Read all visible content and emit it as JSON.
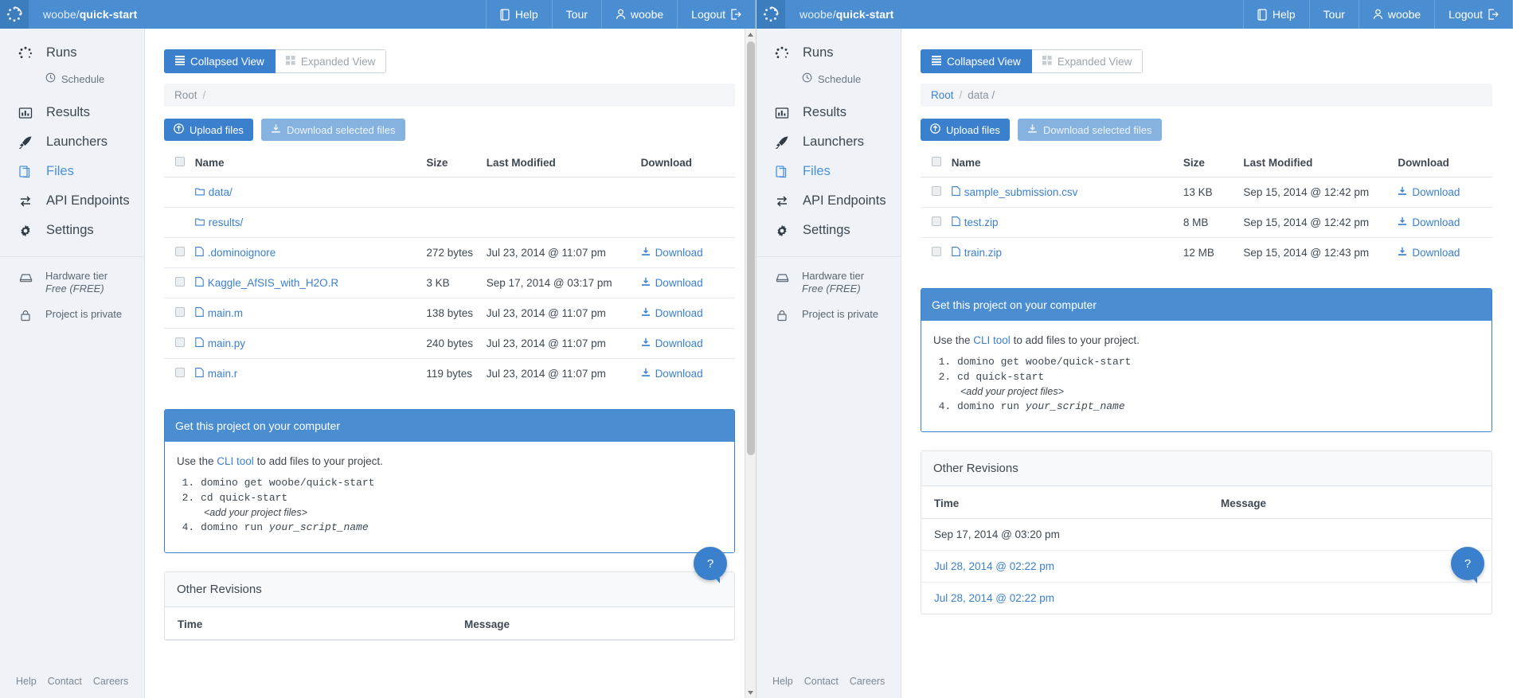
{
  "topbar": {
    "owner": "woobe/",
    "project": "quick-start",
    "nav": [
      {
        "label": "Help",
        "icon": "book-icon"
      },
      {
        "label": "Tour",
        "icon": null
      },
      {
        "label": "woobe",
        "icon": "user-icon"
      },
      {
        "label": "Logout",
        "icon": "logout-icon"
      }
    ]
  },
  "sidebar": {
    "items": [
      {
        "label": "Runs",
        "icon": "spinner-icon",
        "active": false
      },
      {
        "label": "Results",
        "icon": "chart-icon",
        "active": false
      },
      {
        "label": "Launchers",
        "icon": "rocket-icon",
        "active": false
      },
      {
        "label": "Files",
        "icon": "files-icon",
        "active": true
      },
      {
        "label": "API Endpoints",
        "icon": "api-icon",
        "active": false
      },
      {
        "label": "Settings",
        "icon": "gear-icon",
        "active": false
      }
    ],
    "sub_item": {
      "label": "Schedule",
      "icon": "clock-icon"
    },
    "hardware": {
      "label": "Hardware tier",
      "value": "Free  (FREE)",
      "icon": "hardware-icon"
    },
    "privacy": {
      "label": "Project is private",
      "icon": "lock-icon"
    },
    "footer": {
      "links": [
        "Help",
        "Contact",
        "Careers"
      ],
      "menu_icon": "hamburger-icon"
    }
  },
  "view_toggle": {
    "collapsed": "Collapsed View",
    "expanded": "Expanded View",
    "active": "collapsed"
  },
  "buttons": {
    "upload": "Upload files",
    "download_selected": "Download selected files"
  },
  "table_headers": {
    "name": "Name",
    "size": "Size",
    "last_modified": "Last Modified",
    "download": "Download"
  },
  "download_label": "Download",
  "left": {
    "breadcrumb": {
      "root": "Root",
      "sep": "/",
      "path": ""
    },
    "rows": [
      {
        "name": "data/",
        "type": "folder",
        "size": "",
        "modified": "",
        "download": false,
        "checkbox": false
      },
      {
        "name": "results/",
        "type": "folder",
        "size": "",
        "modified": "",
        "download": false,
        "checkbox": false
      },
      {
        "name": ".dominoignore",
        "type": "file",
        "size": "272 bytes",
        "modified": "Jul 23, 2014 @ 11:07 pm",
        "download": true,
        "checkbox": true
      },
      {
        "name": "Kaggle_AfSIS_with_H2O.R",
        "type": "file",
        "size": "3 KB",
        "modified": "Sep 17, 2014 @ 03:17 pm",
        "download": true,
        "checkbox": true
      },
      {
        "name": "main.m",
        "type": "file",
        "size": "138 bytes",
        "modified": "Jul 23, 2014 @ 11:07 pm",
        "download": true,
        "checkbox": true
      },
      {
        "name": "main.py",
        "type": "file",
        "size": "240 bytes",
        "modified": "Jul 23, 2014 @ 11:07 pm",
        "download": true,
        "checkbox": true
      },
      {
        "name": "main.r",
        "type": "file",
        "size": "119 bytes",
        "modified": "Jul 23, 2014 @ 11:07 pm",
        "download": true,
        "checkbox": true
      }
    ]
  },
  "right": {
    "breadcrumb": {
      "root": "Root",
      "sep": "/",
      "path": "data /"
    },
    "rows": [
      {
        "name": "sample_submission.csv",
        "type": "file",
        "size": "13 KB",
        "modified": "Sep 15, 2014 @ 12:42 pm",
        "download": true,
        "checkbox": true
      },
      {
        "name": "test.zip",
        "type": "file",
        "size": "8 MB",
        "modified": "Sep 15, 2014 @ 12:42 pm",
        "download": true,
        "checkbox": true
      },
      {
        "name": "train.zip",
        "type": "file",
        "size": "12 MB",
        "modified": "Sep 15, 2014 @ 12:43 pm",
        "download": true,
        "checkbox": true
      }
    ]
  },
  "cli_panel": {
    "title": "Get this project on your computer",
    "lead_before": "Use the ",
    "lead_link": "CLI tool",
    "lead_after": " to add files to your project.",
    "step1": "domino get woobe/quick-start",
    "step2": "cd quick-start",
    "step2_note": "<add your project files>",
    "step3_cmd": "domino run ",
    "step3_arg": "your_script_name"
  },
  "revisions": {
    "title": "Other Revisions",
    "col_time": "Time",
    "col_message": "Message",
    "rows": [
      {
        "time": "Sep 17, 2014 @ 03:20 pm",
        "message": "",
        "link": false
      },
      {
        "time": "Jul 28, 2014 @ 02:22 pm",
        "message": "",
        "link": true
      },
      {
        "time": "Jul 28, 2014 @ 02:22 pm",
        "message": "",
        "link": true
      }
    ]
  },
  "colors": {
    "brand_blue": "#4a8ed1",
    "primary": "#3b80cc",
    "sidebar_bg": "#eff3f7",
    "link": "#3b80cc"
  },
  "help_fab": {
    "icon": "question-mark-icon"
  }
}
